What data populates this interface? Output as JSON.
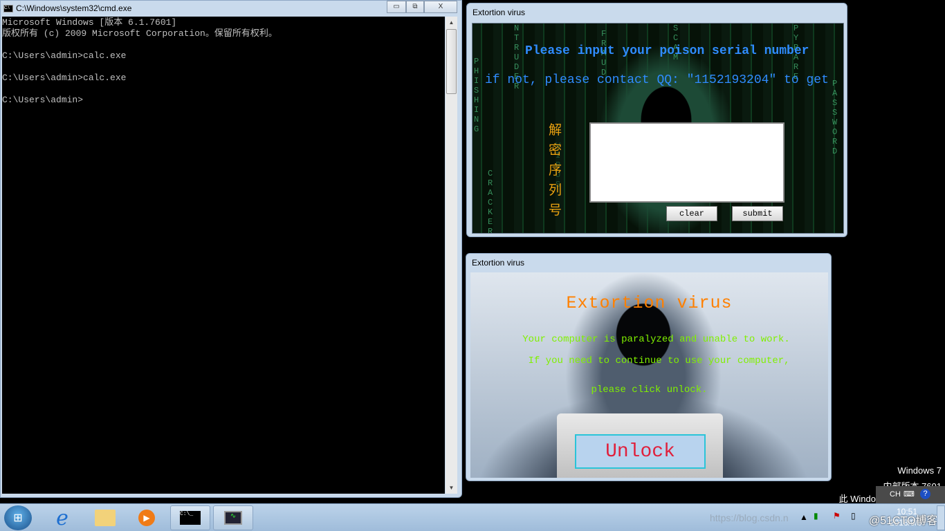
{
  "cmd": {
    "title": "C:\\Windows\\system32\\cmd.exe",
    "icon": "cmd-icon",
    "controls": {
      "minimize": "▭",
      "maximize": "⧉",
      "close": "X"
    },
    "lines": [
      "Microsoft Windows [版本 6.1.7601]",
      "版权所有 (c) 2009 Microsoft Corporation。保留所有权利。",
      "",
      "C:\\Users\\admin>calc.exe",
      "",
      "C:\\Users\\admin>calc.exe",
      "",
      "C:\\Users\\admin>"
    ]
  },
  "virus1": {
    "title": "Extortion virus",
    "line1": "Please input your poison serial number",
    "line2": "if not, please contact QQ: ″1152193204″ to get",
    "vertical_label": "解密序列号",
    "serial_value": "",
    "clear": "clear",
    "submit": "submit",
    "matrix": [
      "NTRUDER",
      "FRAUD",
      "SCAM",
      "PYRARE",
      "PHISHING",
      "CRACKER",
      "PASSWORD",
      "VIRUS"
    ]
  },
  "virus2": {
    "title": "Extortion virus",
    "heading": "Extortion virus",
    "msg1": "Your computer is paralyzed and unable to work.",
    "msg2": "If you need to continue to use your computer,",
    "msg3": "please click unlock.",
    "unlock": "Unlock"
  },
  "watermark": {
    "line1": "Windows 7",
    "line2": "内部版本 7601",
    "line3": "此 Windo"
  },
  "langbar": {
    "lang": "CH"
  },
  "taskbar": {
    "items": [
      "start-button",
      "internet-explorer",
      "windows-explorer",
      "media-player",
      "cmd",
      "resource-monitor"
    ],
    "time": "10:51",
    "date": "2018/9/9",
    "overlay": "https://blog.csdn.n",
    "credit": "@51CTO博客"
  },
  "colors": {
    "heading": "#ff8000",
    "message": "#80f000",
    "unlock_text": "#e0203c",
    "serial_text": "#2f8cff",
    "label": "#e8a010"
  }
}
